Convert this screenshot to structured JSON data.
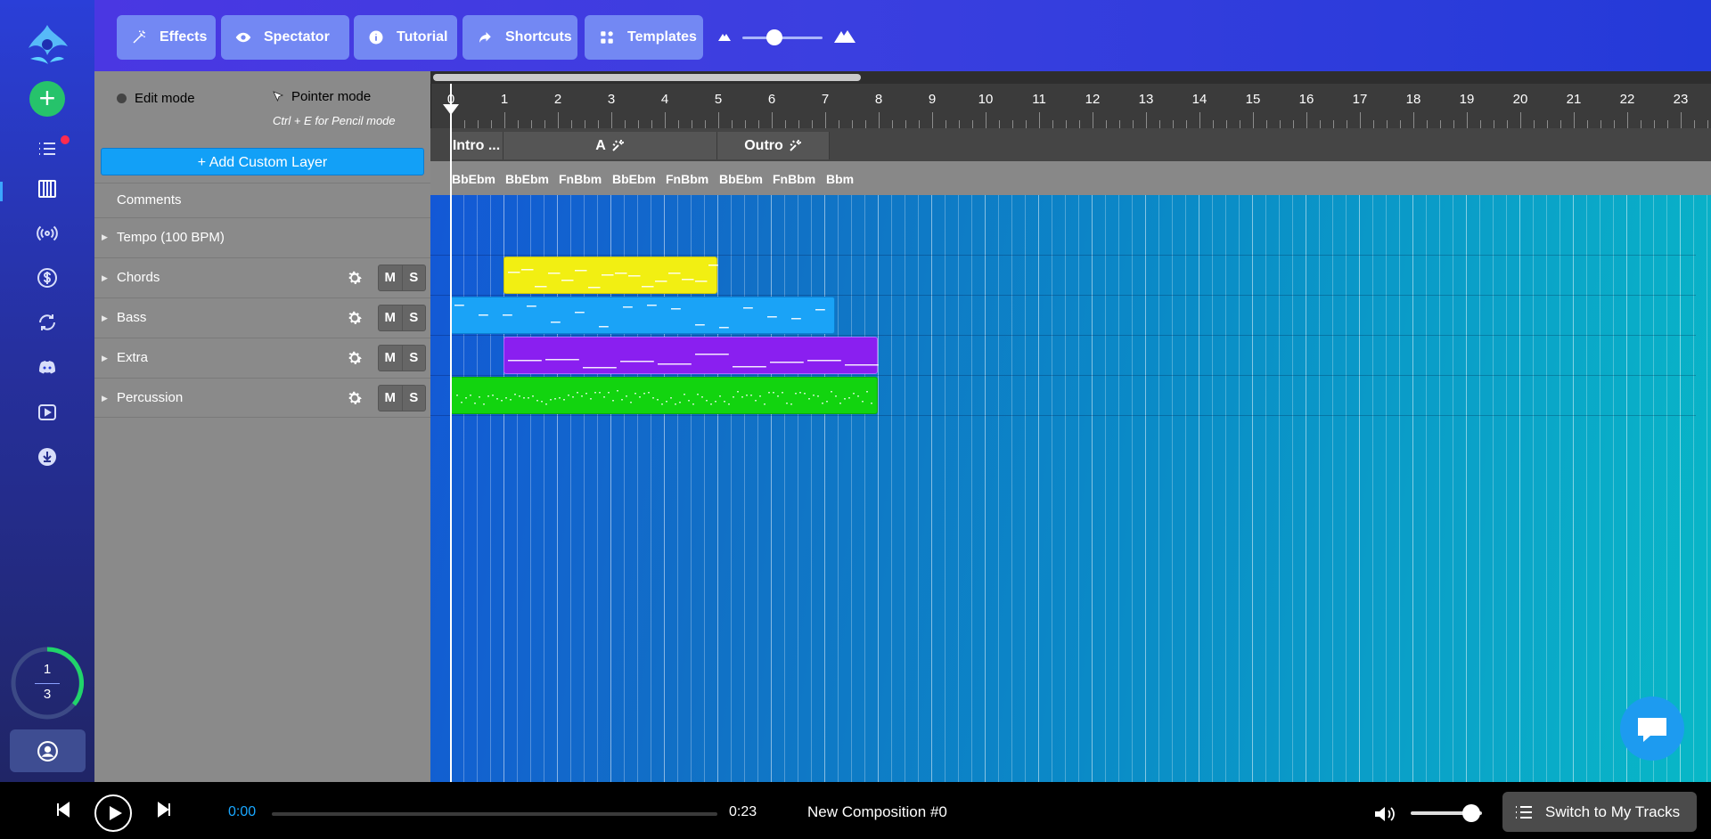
{
  "toolbar": {
    "buttons": [
      {
        "label": "Effects",
        "icon": "magic-wand-icon"
      },
      {
        "label": "Spectator",
        "icon": "eye-icon"
      },
      {
        "label": "Tutorial",
        "icon": "info-icon"
      },
      {
        "label": "Shortcuts",
        "icon": "share-arrow-icon"
      },
      {
        "label": "Templates",
        "icon": "grid-icon"
      }
    ],
    "zoom_level": 0.4
  },
  "sidebar": {
    "counter_top": "1",
    "counter_bottom": "3",
    "notification": true,
    "icons": [
      "plus-icon",
      "list-icon",
      "piano-icon",
      "broadcast-icon",
      "dollar-icon",
      "refresh-icon",
      "discord-icon",
      "video-icon",
      "download-icon",
      "user-icon"
    ]
  },
  "layers_panel": {
    "edit_mode_label": "Edit mode",
    "pointer_mode_label": "Pointer mode",
    "pencil_hint": "Ctrl + E for Pencil mode",
    "add_layer_label": "+ Add Custom Layer",
    "comments_label": "Comments",
    "tempo_label": "Tempo (100 BPM)",
    "mute_label": "M",
    "solo_label": "S",
    "layers": [
      "Chords",
      "Bass",
      "Extra",
      "Percussion"
    ]
  },
  "timeline": {
    "bar_numbers": [
      "0",
      "1",
      "2",
      "3",
      "4",
      "5",
      "6",
      "7",
      "8",
      "9",
      "10",
      "11",
      "12",
      "13",
      "14",
      "15",
      "16",
      "17",
      "18",
      "19",
      "20",
      "21",
      "22",
      "23"
    ],
    "sections": [
      {
        "label": "Intro ...",
        "start": 0,
        "end": 1,
        "settings": false
      },
      {
        "label": "A",
        "start": 1,
        "end": 5,
        "settings": true
      },
      {
        "label": "Outro",
        "start": 5,
        "end": 7.1,
        "settings": true
      }
    ],
    "chords": [
      "BbEbm",
      "BbEbm",
      "FnBbm",
      "BbEbm",
      "FnBbm",
      "BbEbm",
      "FnBbm",
      "Bbm"
    ],
    "clips": [
      {
        "layer": "Chords",
        "start": 1,
        "end": 5,
        "color": "#f2ef12",
        "border": "#c7c40a"
      },
      {
        "layer": "Bass",
        "start": 0,
        "end": 7.2,
        "color": "#1aa3f7",
        "border": "#0c7fd0"
      },
      {
        "layer": "Extra",
        "start": 1,
        "end": 8,
        "color": "#8a1ff0",
        "border": "#b066ff"
      },
      {
        "layer": "Percussion",
        "start": 0,
        "end": 8,
        "color": "#12d40f",
        "border": "#0ca80a"
      }
    ]
  },
  "player": {
    "current_time": "0:00",
    "total_time": "0:23",
    "title": "New Composition #0",
    "progress": 0,
    "volume": 0.85,
    "switch_label": "Switch to My Tracks"
  }
}
